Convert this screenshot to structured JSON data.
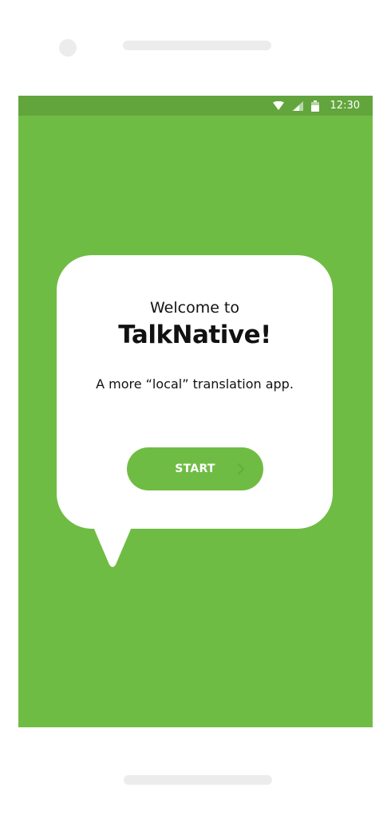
{
  "colors": {
    "brand_green": "#6fbc44",
    "status_bar_green": "#62a53d",
    "bubble_white": "#ffffff",
    "chevron_dim_green": "#5fae3a"
  },
  "status_bar": {
    "time": "12:30",
    "icons": [
      "wifi-icon",
      "signal-icon",
      "battery-icon"
    ]
  },
  "welcome": {
    "line1": "Welcome to",
    "app_name": "TalkNative!",
    "tagline": "A more “local” translation app."
  },
  "start_button": {
    "label": "START",
    "icon": "chevron-right-icon"
  }
}
